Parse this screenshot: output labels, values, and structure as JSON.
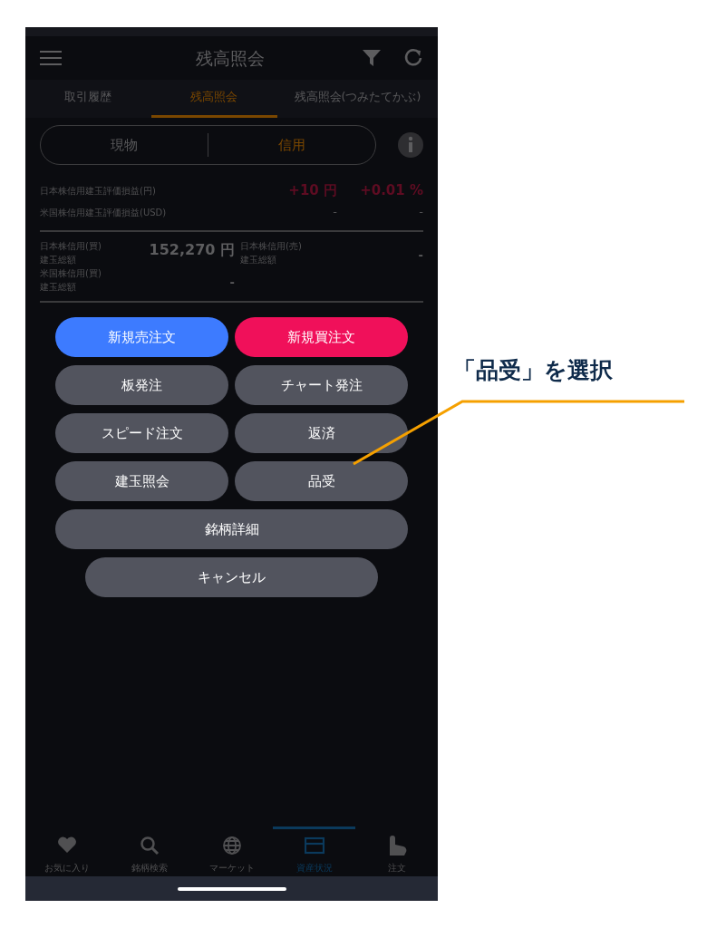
{
  "header": {
    "title": "残高照会"
  },
  "tabs": [
    {
      "label": "取引履歴",
      "selected": false
    },
    {
      "label": "残高照会",
      "selected": true
    },
    {
      "label": "残高照会(つみたてかぶ)",
      "selected": false
    }
  ],
  "segments": [
    {
      "label": "現物",
      "selected": false
    },
    {
      "label": "信用",
      "selected": true
    }
  ],
  "pl_rows": [
    {
      "label": "日本株信用建玉評価損益(円)",
      "value": "+10 円",
      "percent": "+0.01 %",
      "kind": "gain"
    },
    {
      "label": "米国株信用建玉評価損益(USD)",
      "value": "-",
      "percent": "-",
      "kind": "none"
    }
  ],
  "totals": [
    {
      "label": [
        "日本株信用(買)",
        "建玉総額"
      ],
      "value": "152,270 円"
    },
    {
      "label": [
        "日本株信用(売)",
        "建玉総額"
      ],
      "value": "-"
    },
    {
      "label": [
        "米国株信用(買)",
        "建玉総額"
      ],
      "value": "-"
    }
  ],
  "action_menu": [
    {
      "label": "新規売注文",
      "kind": "sell"
    },
    {
      "label": "新規買注文",
      "kind": "buy"
    },
    {
      "label": "板発注",
      "kind": "normal"
    },
    {
      "label": "チャート発注",
      "kind": "normal"
    },
    {
      "label": "スピード注文",
      "kind": "normal"
    },
    {
      "label": "返済",
      "kind": "normal"
    },
    {
      "label": "建玉照会",
      "kind": "normal"
    },
    {
      "label": "品受",
      "kind": "normal"
    },
    {
      "label": "銘柄詳細",
      "kind": "wide"
    },
    {
      "label": "キャンセル",
      "kind": "cancel"
    }
  ],
  "bottom_nav": [
    {
      "label": "お気に入り",
      "selected": false
    },
    {
      "label": "銘柄検索",
      "selected": false
    },
    {
      "label": "マーケット",
      "selected": false
    },
    {
      "label": "資産状況",
      "selected": true
    },
    {
      "label": "注文",
      "selected": false
    }
  ],
  "annotation": {
    "text": "「品受」を選択"
  }
}
